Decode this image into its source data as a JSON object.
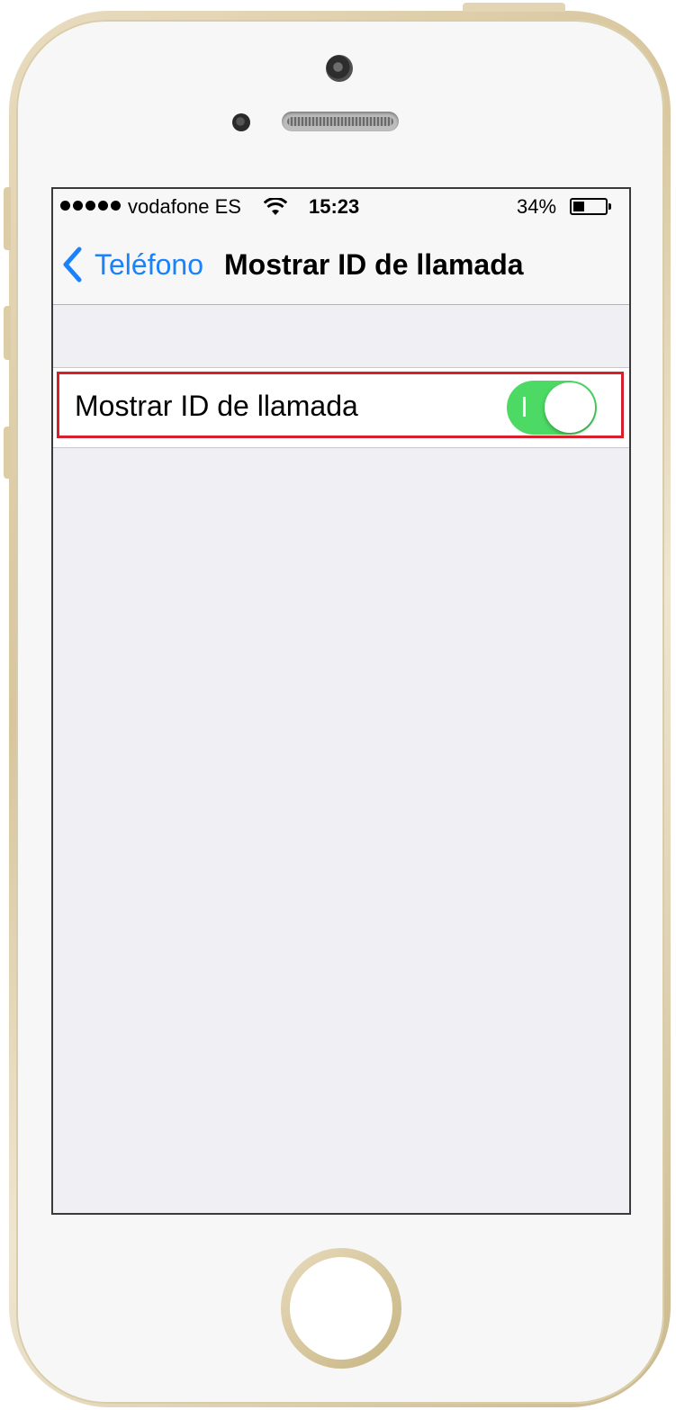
{
  "status_bar": {
    "carrier": "vodafone ES",
    "time": "15:23",
    "battery_percent": "34%",
    "battery_level": 0.34,
    "signal_bars": 5
  },
  "nav": {
    "back_label": "Teléfono",
    "title": "Mostrar ID de llamada"
  },
  "settings": {
    "show_caller_id_label": "Mostrar ID de llamada",
    "show_caller_id_on": true,
    "toggle_on_glyph": "I"
  },
  "colors": {
    "accent_blue": "#1a82fb",
    "toggle_green": "#4cd964",
    "highlight_red": "#d6202b",
    "grouped_background": "#efeff4"
  },
  "icons": [
    "wifi-icon",
    "battery-icon",
    "back-chevron-icon"
  ]
}
